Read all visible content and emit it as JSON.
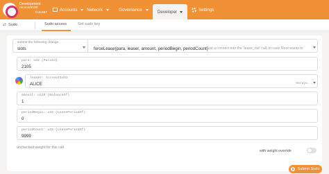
{
  "header": {
    "chain_name": "Development",
    "runtime": "rococo/9180",
    "block": "#18,867",
    "nav": [
      {
        "label": "Accounts"
      },
      {
        "label": "Network"
      },
      {
        "label": "Governance"
      },
      {
        "label": "Developer"
      },
      {
        "label": "Settings"
      }
    ],
    "accent_color": "#f19135"
  },
  "subnav": {
    "section": "Sudo",
    "tabs": [
      {
        "label": "Sudo access",
        "active": true
      },
      {
        "label": "Set sudo key",
        "active": false
      }
    ]
  },
  "form": {
    "submit_label": "submit the following change",
    "section_value": "slots",
    "method_value": "forceLease(para, leaser, amount, periodBegin, periodCount)",
    "method_hint": "Just a connect into the 'lease_out' call, in case Root wants to",
    "params": [
      {
        "label": "para: u32 (ParaId)",
        "value": "2105"
      },
      {
        "label": "leaser: AccountId32",
        "value": "ALICE",
        "address": "5Grwva..."
      },
      {
        "label": "amount: u128 (BalanceOf)",
        "value": "1"
      },
      {
        "label": "periodBegin: u32 (LeasePeriodOf)",
        "value": "0"
      },
      {
        "label": "periodCount: u32 (LeasePeriodOf)",
        "value": "9999"
      }
    ],
    "weight_label": "unchecked weight for this call",
    "override_label": "with weight override",
    "submit_button": "Submit Sudo"
  }
}
